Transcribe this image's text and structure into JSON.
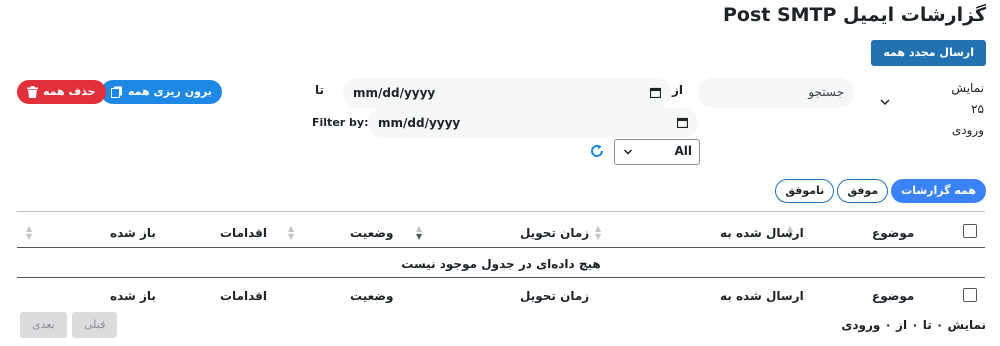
{
  "page": {
    "title": "گزارشات ایمیل Post SMTP"
  },
  "actions": {
    "resend_all": "ارسال مجدد همه",
    "export_all": "برون ریزی همه",
    "delete_all": "حذف همه"
  },
  "length_menu": {
    "label_top": "نمایش",
    "value": "۲۵",
    "label_bottom": "ورودی"
  },
  "search": {
    "placeholder": "جستجو"
  },
  "date_filter": {
    "from_label": "از",
    "to_label": "تا",
    "from_value": "mm/dd/yyyy",
    "to_value": "mm/dd/yyyy",
    "filter_by_label": "Filter by:"
  },
  "status_select": {
    "selected": "All"
  },
  "tabs": [
    {
      "label": "همه گزارشات",
      "active": true
    },
    {
      "label": "موفق",
      "active": false
    },
    {
      "label": "ناموفق",
      "active": false
    }
  ],
  "table": {
    "columns": [
      "موضوع",
      "ارسال شده به",
      "زمان تحویل",
      "وضعیت",
      "اقدامات",
      "باز شده"
    ],
    "empty_message": "هیچ داده‌ای در جدول موجود نیست"
  },
  "pagination": {
    "info": "نمایش ۰ تا ۰ از ۰ ورودی",
    "previous": "قبلی",
    "next": "بعدی"
  },
  "colors": {
    "primary": "#2271b1",
    "export": "#1e88e5",
    "danger": "#e0303a",
    "tab_active": "#3b82f6"
  }
}
